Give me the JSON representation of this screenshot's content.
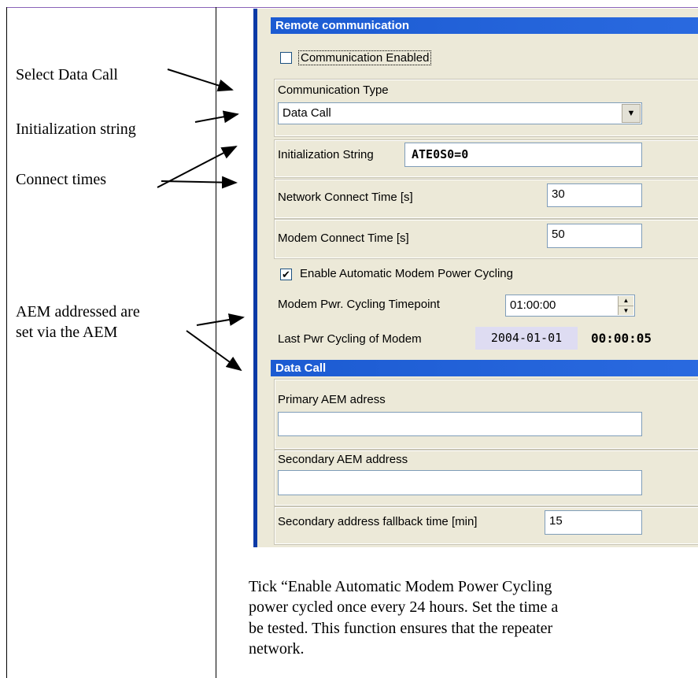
{
  "left_notes": {
    "select_data_call": "Select Data Call",
    "initialization_string": "Initialization string",
    "connect_times": "Connect times",
    "aem_line1": "AEM addressed are",
    "aem_line2": "set via the AEM"
  },
  "remote_communication": {
    "header": "Remote communication",
    "communication_enabled_label": "Communication Enabled",
    "communication_enabled_checked": false,
    "communication_type_label": "Communication Type",
    "communication_type_value": "Data Call",
    "initialization_string_label": "Initialization String",
    "initialization_string_value": "ATE0S0=0",
    "network_connect_time_label": "Network Connect Time [s]",
    "network_connect_time_value": "30",
    "modem_connect_time_label": "Modem Connect Time [s]",
    "modem_connect_time_value": "50",
    "auto_power_cycling_label": "Enable Automatic Modem Power Cycling",
    "auto_power_cycling_checked": true,
    "check_mark": "✔",
    "power_cycling_timepoint_label": "Modem Pwr. Cycling Timepoint",
    "power_cycling_timepoint_value": "01:00:00",
    "last_power_cycling_label": "Last Pwr Cycling of Modem",
    "last_power_cycling_date": "2004-01-01",
    "last_power_cycling_time": "00:00:05"
  },
  "data_call": {
    "header": "Data Call",
    "primary_address_label": "Primary AEM adress",
    "primary_address_value": "",
    "secondary_address_label": "Secondary AEM address",
    "secondary_address_value": "",
    "fallback_time_label": "Secondary address fallback time [min]",
    "fallback_time_value": "15"
  },
  "paragraph": {
    "line1": "Tick “Enable Automatic Modem Power Cycling",
    "line2": "power cycled once every 24 hours. Set the time a",
    "line3": "be tested. This function ensures that the repeater",
    "line4": "network."
  },
  "icons": {
    "dropdown_arrow": "▼",
    "spin_up": "▲",
    "spin_down": "▼"
  }
}
